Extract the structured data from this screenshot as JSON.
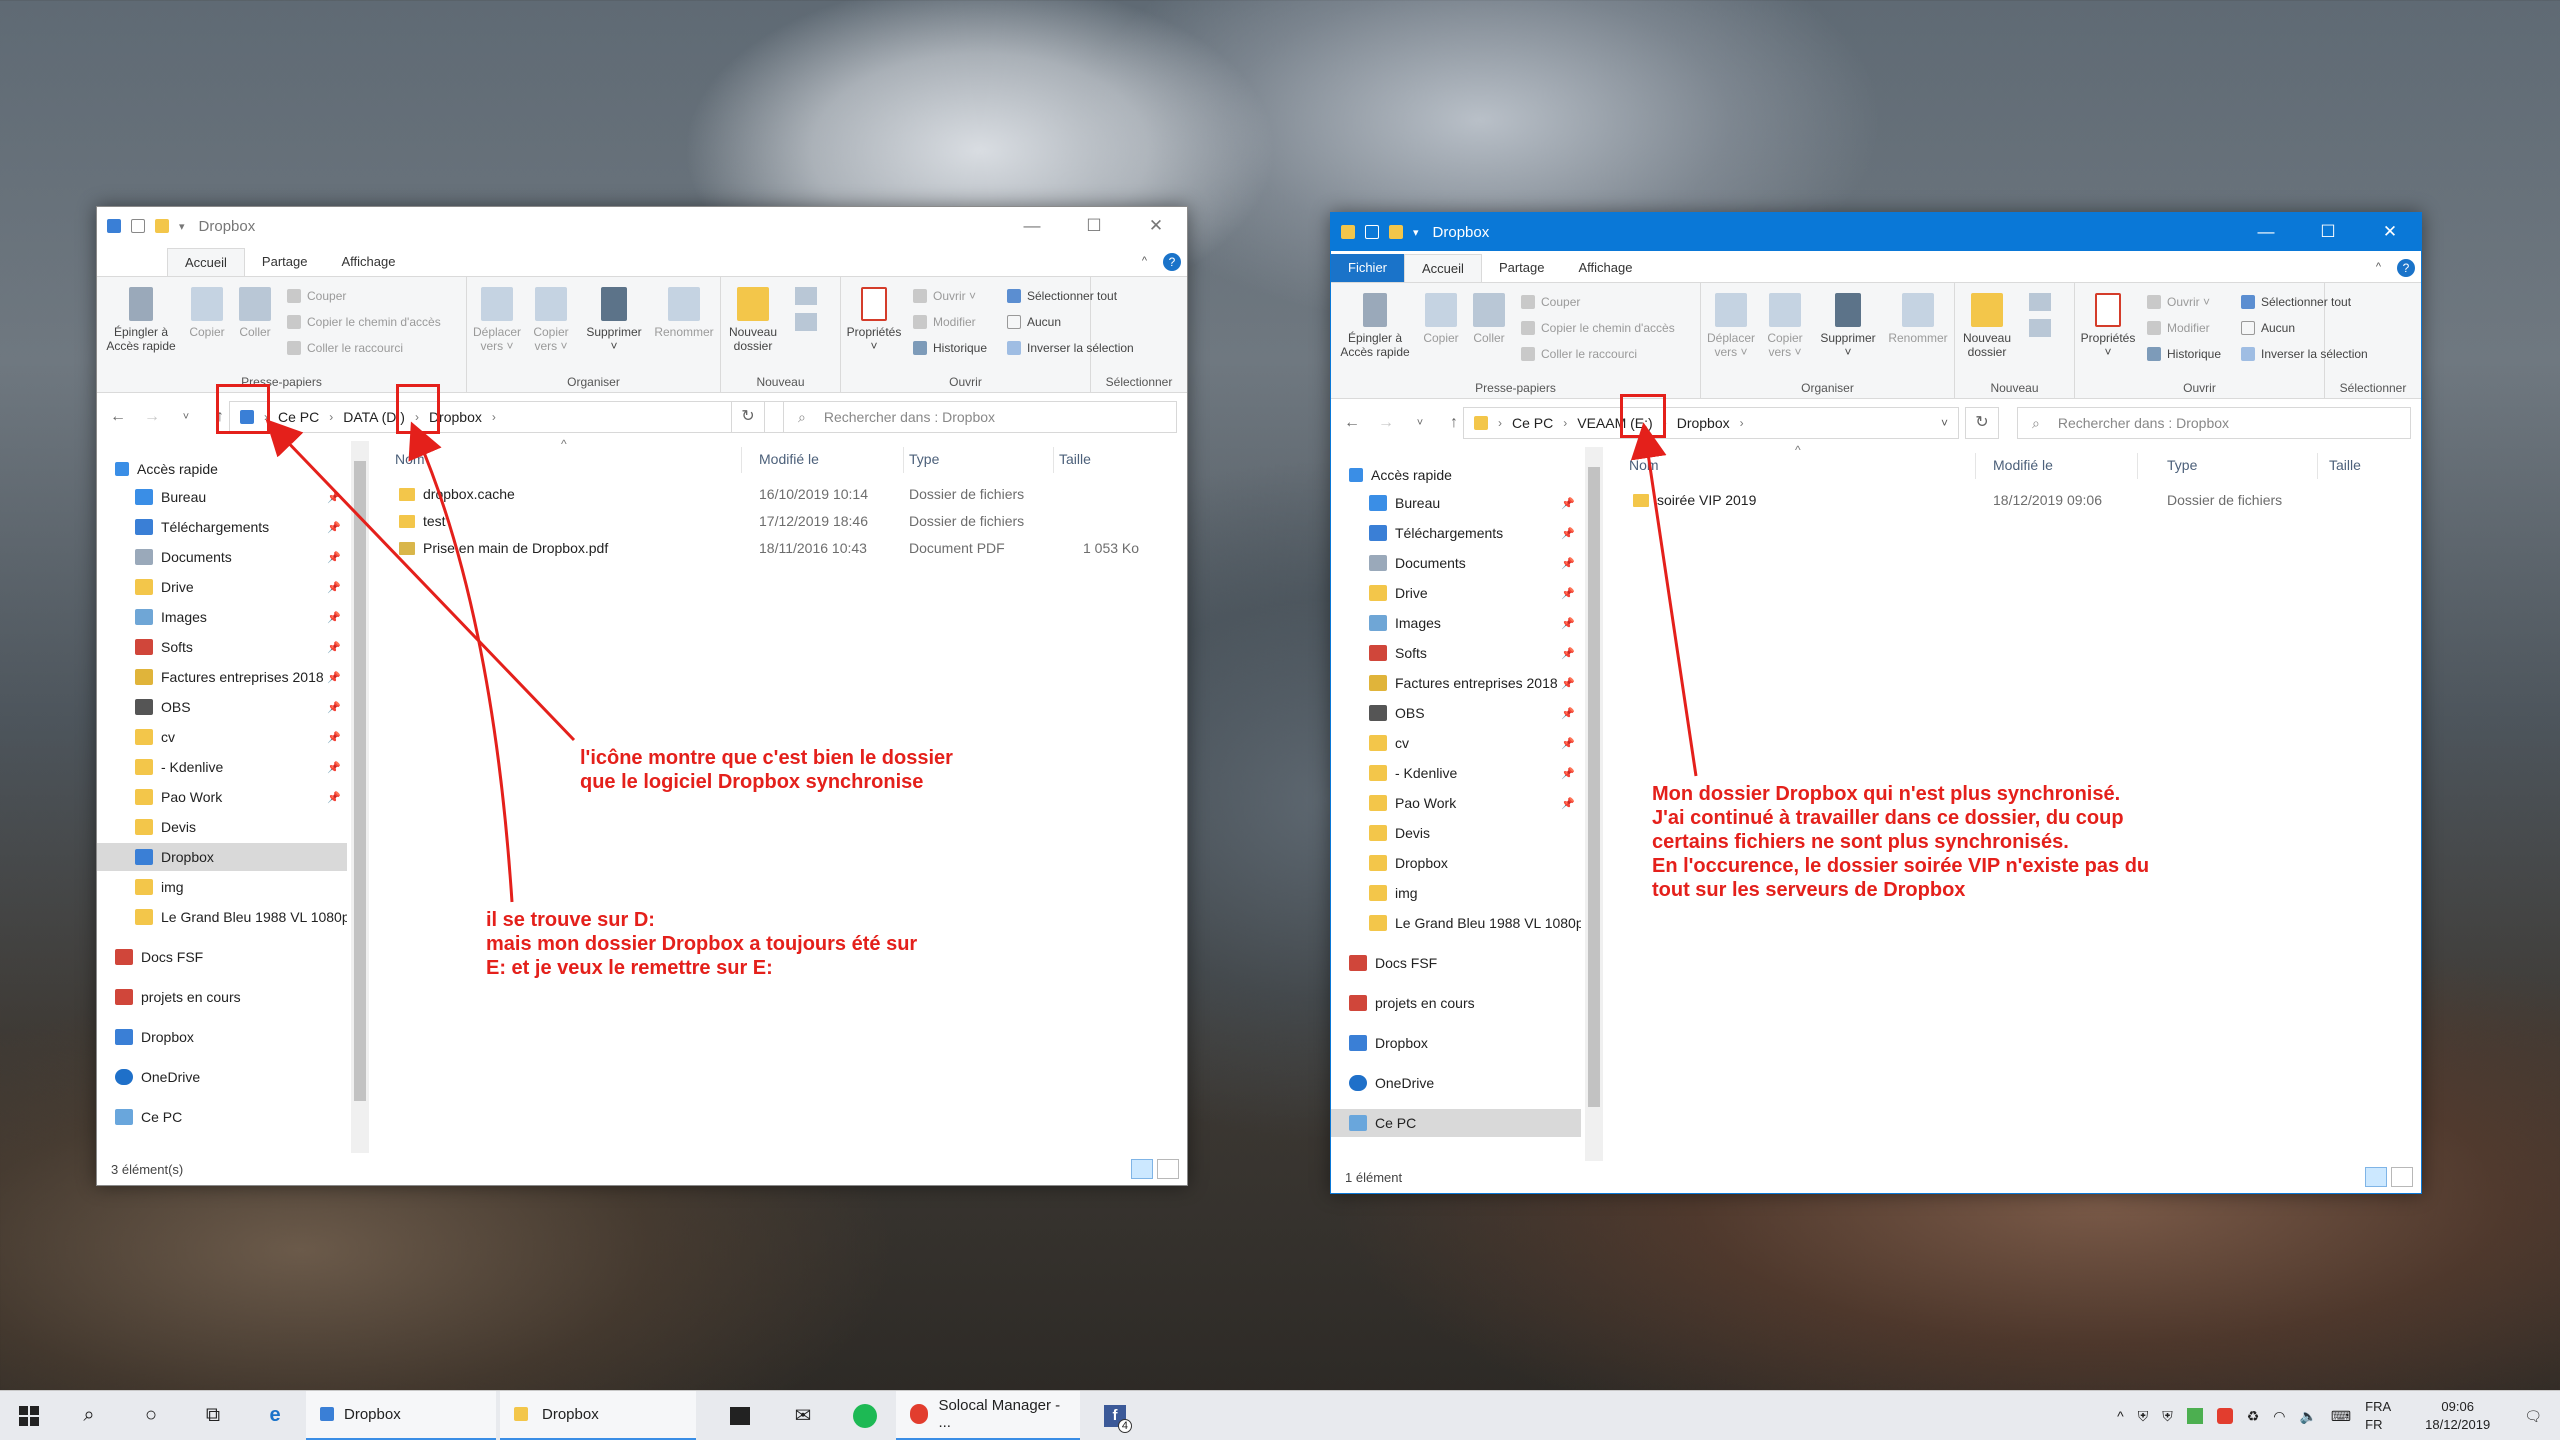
{
  "explorer_left": {
    "title": "Dropbox",
    "ribbon_tabs": [
      "Accueil",
      "Partage",
      "Affichage"
    ],
    "ribbon": {
      "pin_label": "Épingler à\nAccès rapide",
      "copy": "Copier",
      "paste": "Coller",
      "cut": "Couper",
      "copy_path": "Copier le chemin d'accès",
      "paste_shortcut": "Coller le raccourci",
      "clipboard_group": "Presse-papiers",
      "move_to": "Déplacer\nvers ˅",
      "copy_to": "Copier\nvers ˅",
      "delete": "Supprimer\n˅",
      "rename": "Renommer",
      "organize_group": "Organiser",
      "new_folder": "Nouveau\ndossier",
      "new_group": "Nouveau",
      "properties": "Propriétés\n˅",
      "open": "Ouvrir ˅",
      "edit": "Modifier",
      "history": "Historique",
      "open_group": "Ouvrir",
      "select_all": "Sélectionner tout",
      "select_none": "Aucun",
      "invert_selection": "Inverser la sélection",
      "select_group": "Sélectionner"
    },
    "breadcrumb": [
      "Ce PC",
      "DATA (D:)",
      "Dropbox"
    ],
    "search_placeholder": "Rechercher dans : Dropbox",
    "columns": [
      "Nom",
      "Modifié le",
      "Type",
      "Taille"
    ],
    "files": [
      {
        "name": "dropbox.cache",
        "date": "16/10/2019 10:14",
        "type": "Dossier de fichiers",
        "size": ""
      },
      {
        "name": "test",
        "date": "17/12/2019 18:46",
        "type": "Dossier de fichiers",
        "size": ""
      },
      {
        "name": "Prise en main de Dropbox.pdf",
        "date": "18/11/2016 10:43",
        "type": "Document PDF",
        "size": "1 053 Ko"
      }
    ],
    "status": "3 élément(s)"
  },
  "explorer_right": {
    "title": "Dropbox",
    "file_tab": "Fichier",
    "ribbon_tabs": [
      "Accueil",
      "Partage",
      "Affichage"
    ],
    "breadcrumb": [
      "Ce PC",
      "VEAAM (E:)",
      "Dropbox"
    ],
    "search_placeholder": "Rechercher dans : Dropbox",
    "columns": [
      "Nom",
      "Modifié le",
      "Type",
      "Taille"
    ],
    "files": [
      {
        "name": "soirée VIP 2019",
        "date": "18/12/2019 09:06",
        "type": "Dossier de fichiers",
        "size": ""
      }
    ],
    "status": "1 élément"
  },
  "nav_pane": {
    "quick_access": "Accès rapide",
    "items": [
      "Bureau",
      "Téléchargements",
      "Documents",
      "Drive",
      "Images",
      "Softs",
      "Factures entreprises 2018",
      "OBS",
      "cv",
      "- Kdenlive",
      "Pao Work",
      "Devis",
      "Dropbox",
      "img",
      "Le Grand Bleu 1988 VL 1080p"
    ],
    "roots": [
      "Docs FSF",
      "projets en cours",
      "Dropbox",
      "OneDrive",
      "Ce PC"
    ]
  },
  "annotations": {
    "a1": "l'icône montre que c'est bien le dossier\nque le logiciel Dropbox synchronise",
    "a2": "il se trouve sur D:\nmais mon dossier Dropbox a toujours été sur\nE: et je veux le remettre sur E:",
    "a3": "Mon dossier Dropbox qui n'est plus synchronisé.\nJ'ai continué à travailler dans ce dossier, du coup\ncertains fichiers ne sont plus synchronisés.\nEn l'occurence, le dossier soirée VIP n'existe pas du\ntout sur les serveurs de Dropbox"
  },
  "taskbar": {
    "app1": "Dropbox",
    "app2": "Dropbox",
    "app3": "Solocal Manager - ...",
    "badge": "4",
    "lang_top": "FRA",
    "lang_bottom": "FR",
    "time": "09:06",
    "date": "18/12/2019"
  },
  "colors": {
    "accent": "#0a78d7",
    "annotation": "#e4201b",
    "folder": "#f3c64a"
  }
}
